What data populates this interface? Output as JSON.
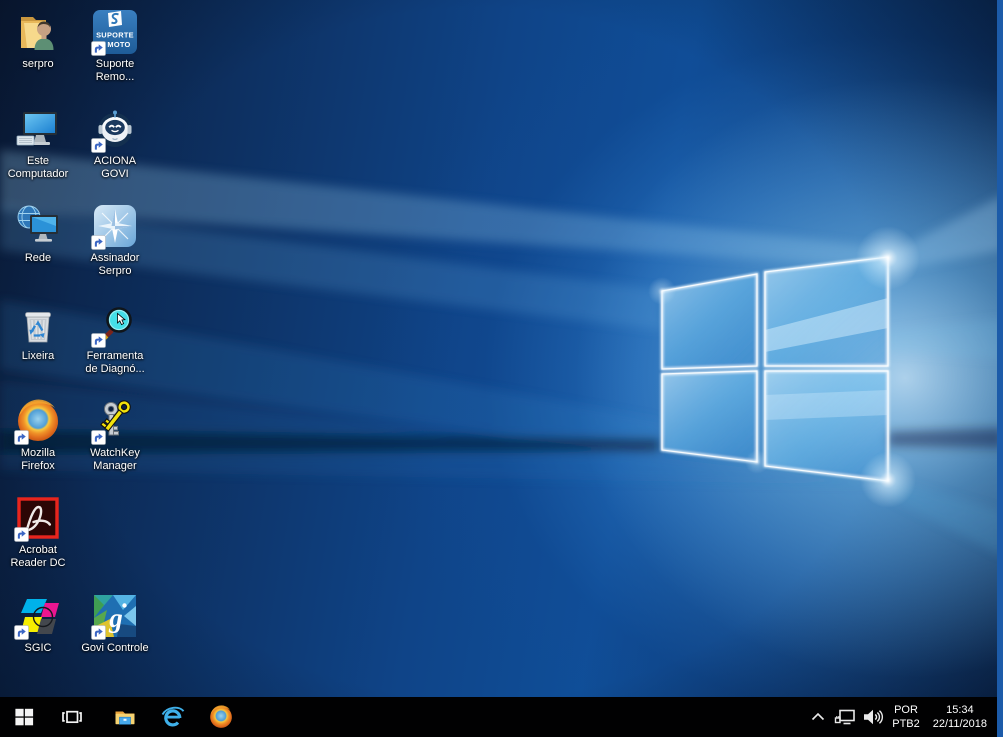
{
  "desktop": {
    "icons": [
      {
        "name": "serpro",
        "type": "folder-user",
        "lines": [
          "serpro"
        ],
        "col": 0,
        "row": 0,
        "shortcut": false
      },
      {
        "name": "suporte-remoto",
        "type": "suporte-tile",
        "lines": [
          "Suporte",
          "Remo..."
        ],
        "col": 1,
        "row": 0,
        "shortcut": true,
        "tile": [
          "SUPORTE",
          "MOTO"
        ]
      },
      {
        "name": "este-computador",
        "type": "this-pc",
        "lines": [
          "Este",
          "Computador"
        ],
        "col": 0,
        "row": 1,
        "shortcut": false
      },
      {
        "name": "aciona-govi",
        "type": "robot",
        "lines": [
          "ACIONA",
          "GOVI"
        ],
        "col": 1,
        "row": 1,
        "shortcut": true
      },
      {
        "name": "rede",
        "type": "network-pc",
        "lines": [
          "Rede"
        ],
        "col": 0,
        "row": 2,
        "shortcut": false
      },
      {
        "name": "assinador-serpro",
        "type": "assinador-tile",
        "lines": [
          "Assinador",
          "Serpro"
        ],
        "col": 1,
        "row": 2,
        "shortcut": true
      },
      {
        "name": "lixeira",
        "type": "recycle-bin",
        "lines": [
          "Lixeira"
        ],
        "col": 0,
        "row": 3,
        "shortcut": false
      },
      {
        "name": "ferramenta-de-diagnostico",
        "type": "magnifier",
        "lines": [
          "Ferramenta",
          "de Diagnó..."
        ],
        "col": 1,
        "row": 3,
        "shortcut": true
      },
      {
        "name": "mozilla-firefox",
        "type": "firefox",
        "lines": [
          "Mozilla",
          "Firefox"
        ],
        "col": 0,
        "row": 4,
        "shortcut": true
      },
      {
        "name": "watchkey-manager",
        "type": "keys",
        "lines": [
          "WatchKey",
          "Manager"
        ],
        "col": 1,
        "row": 4,
        "shortcut": true
      },
      {
        "name": "acrobat-reader-dc",
        "type": "acrobat",
        "lines": [
          "Acrobat",
          "Reader DC"
        ],
        "col": 0,
        "row": 5,
        "shortcut": true
      },
      {
        "name": "sgic",
        "type": "sgic",
        "lines": [
          "SGIC"
        ],
        "col": 0,
        "row": 6,
        "shortcut": true
      },
      {
        "name": "govi-controle",
        "type": "govi-tile",
        "lines": [
          "Govi Controle"
        ],
        "col": 1,
        "row": 6,
        "shortcut": true,
        "letter": "g"
      }
    ]
  },
  "taskbar": {
    "buttons": [
      {
        "name": "start"
      },
      {
        "name": "task-view"
      },
      {
        "name": "file-explorer"
      },
      {
        "name": "internet-explorer"
      },
      {
        "name": "firefox"
      }
    ],
    "tray": {
      "icons": [
        "hidden-icons-chevron",
        "network",
        "volume"
      ],
      "language": {
        "line1": "POR",
        "line2": "PTB2"
      },
      "clock": {
        "time": "15:34",
        "date": "22/11/2018"
      }
    }
  },
  "colors": {
    "taskbar_bg": "#010102",
    "session_border": "#1c5ba9",
    "wallpaper_accent": "#2f86d2"
  }
}
